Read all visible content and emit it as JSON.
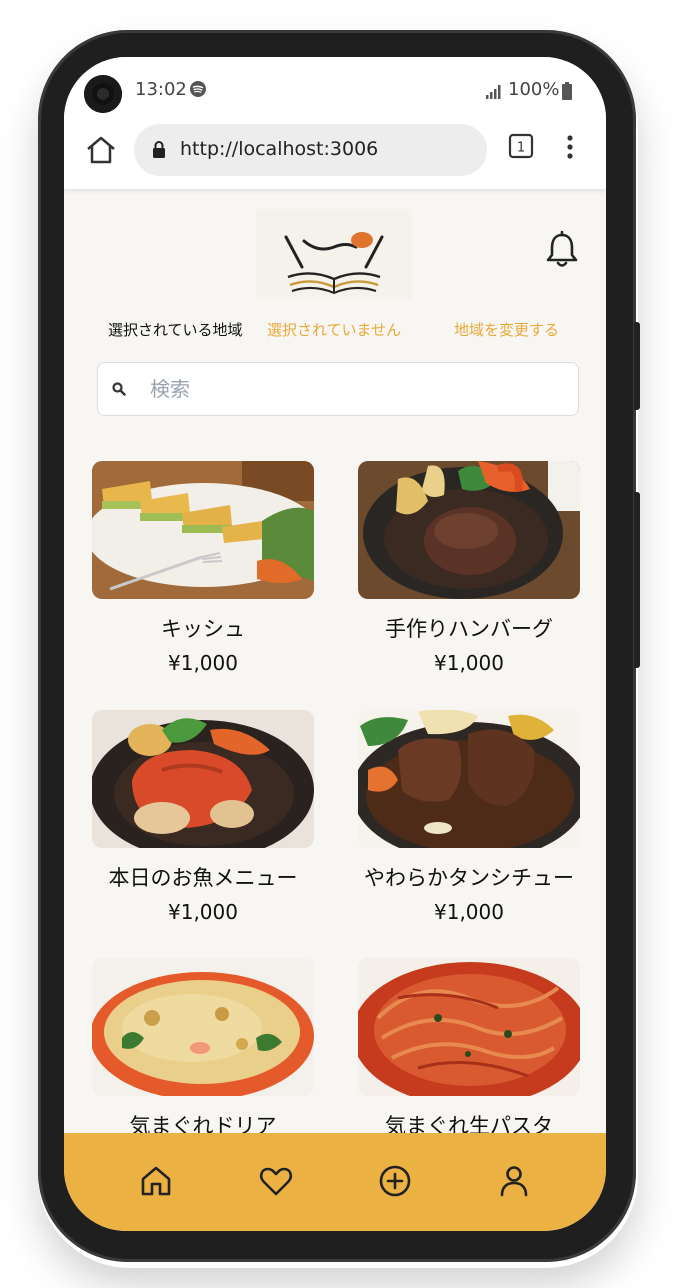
{
  "status_bar": {
    "time": "13:02",
    "battery": "100%"
  },
  "browser": {
    "url": "http://localhost:3006",
    "tab_count": "1"
  },
  "header": {
    "region_label": "選択されている地域",
    "region_value": "選択されていません",
    "region_change": "地域を変更する"
  },
  "search": {
    "placeholder": "検索"
  },
  "menu_items": [
    {
      "name": "キッシュ",
      "price": "¥1,000"
    },
    {
      "name": "手作りハンバーグ",
      "price": "¥1,000"
    },
    {
      "name": "本日のお魚メニュー",
      "price": "¥1,000"
    },
    {
      "name": "やわらかタンシチュー",
      "price": "¥1,000"
    },
    {
      "name": "気まぐれドリア",
      "price": ""
    },
    {
      "name": "気まぐれ生パスタ",
      "price": ""
    }
  ],
  "bottom_nav": {
    "items": [
      "home-icon",
      "heart-icon",
      "plus-circle-icon",
      "user-icon"
    ]
  },
  "colors": {
    "accent": "#ECB143",
    "link": "#E9A93A",
    "background": "#F8F6F2"
  }
}
